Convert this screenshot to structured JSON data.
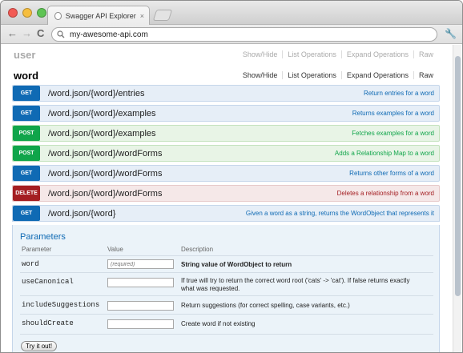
{
  "browser": {
    "tab_title": "Swagger API Explorer",
    "tab_close": "×",
    "back": "←",
    "forward": "→",
    "reload": "C",
    "url": "my-awesome-api.com",
    "wrench": "🔧"
  },
  "resources": {
    "user": {
      "name": "user",
      "links": [
        "Show/Hide",
        "List Operations",
        "Expand Operations",
        "Raw"
      ]
    },
    "word": {
      "name": "word",
      "links": [
        "Show/Hide",
        "List Operations",
        "Expand Operations",
        "Raw"
      ]
    }
  },
  "operations": [
    {
      "method": "GET",
      "path": "/word.json/{word}/entries",
      "summary": "Return entries for a word"
    },
    {
      "method": "GET",
      "path": "/word.json/{word}/examples",
      "summary": "Returns examples for a word"
    },
    {
      "method": "POST",
      "path": "/word.json/{word}/examples",
      "summary": "Fetches examples for a word"
    },
    {
      "method": "POST",
      "path": "/word.json/{word}/wordForms",
      "summary": "Adds a Relationship Map to a word"
    },
    {
      "method": "GET",
      "path": "/word.json/{word}/wordForms",
      "summary": "Returns other forms of a word"
    },
    {
      "method": "DELETE",
      "path": "/word.json/{word}/wordForms",
      "summary": "Deletes a relationship from a word"
    },
    {
      "method": "GET",
      "path": "/word.json/{word}",
      "summary": "Given a word as a string, returns the WordObject that represents it"
    }
  ],
  "parameters": {
    "title": "Parameters",
    "headers": {
      "parameter": "Parameter",
      "value": "Value",
      "description": "Description"
    },
    "rows": [
      {
        "name": "word",
        "value": "",
        "placeholder": "(required)",
        "description": "String value of WordObject to return",
        "bold": true
      },
      {
        "name": "useCanonical",
        "value": "",
        "placeholder": "",
        "description": "If true will try to return the correct word root ('cats' -> 'cat'). If false returns exactly what was requested."
      },
      {
        "name": "includeSuggestions",
        "value": "",
        "placeholder": "",
        "description": "Return suggestions (for correct spelling, case variants, etc.)"
      },
      {
        "name": "shouldCreate",
        "value": "",
        "placeholder": "",
        "description": "Create word if not existing"
      }
    ],
    "try_button": "Try it out!"
  },
  "colors": {
    "get": "#0f6ab4",
    "post": "#10a54a",
    "delete": "#a41e22"
  }
}
